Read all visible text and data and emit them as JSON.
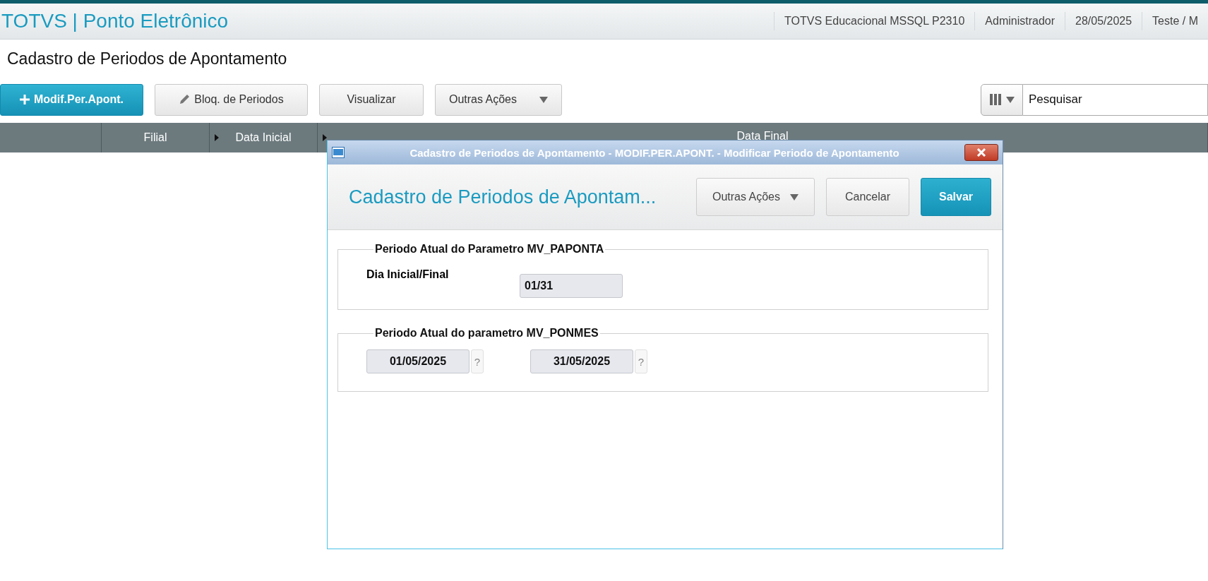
{
  "app": {
    "title": "TOTVS | Ponto Eletrônico",
    "header_items": [
      "TOTVS Educacional MSSQL P2310",
      "Administrador",
      "28/05/2025",
      "Teste / M"
    ]
  },
  "page_title": "Cadastro de Periodos de Apontamento",
  "toolbar": {
    "buttons": [
      {
        "label": "Modif.Per.Apont.",
        "kind": "primary"
      },
      {
        "label": "Bloq. de Periodos",
        "kind": "edit"
      },
      {
        "label": "Visualizar",
        "kind": "plain"
      },
      {
        "label": "Outras Ações",
        "kind": "dropdown"
      }
    ],
    "search": {
      "placeholder": "Pesquisar"
    }
  },
  "grid": {
    "columns": [
      {
        "kind": "blank"
      },
      {
        "label": "Filial",
        "kind": "sort"
      },
      {
        "label": "Data Inicial",
        "kind": "sort"
      },
      {
        "label": "Data Final",
        "kind": "wide"
      }
    ]
  },
  "dialog": {
    "title": "Cadastro de Periodos de Apontamento - MODIF.PER.APONT. - Modificar Periodo de Apontamento",
    "heading": "Cadastro de Periodos de Apontam...",
    "buttons": [
      {
        "label": "Outras Ações",
        "kind": "dropdown"
      },
      {
        "label": "Cancelar",
        "kind": "plain"
      },
      {
        "label": "Salvar",
        "kind": "primary"
      }
    ],
    "groups": [
      {
        "legend": "Periodo Atual do Parametro MV_PAPONTA",
        "fields": [
          {
            "label": "Dia Inicial/Final",
            "value": "01/31"
          }
        ]
      },
      {
        "legend": "Periodo Atual do parametro MV_PONMES",
        "fields": [
          {
            "value": "01/05/2025",
            "help_text": "?"
          },
          {
            "value": "31/05/2025",
            "help_text": "?"
          }
        ]
      }
    ]
  }
}
